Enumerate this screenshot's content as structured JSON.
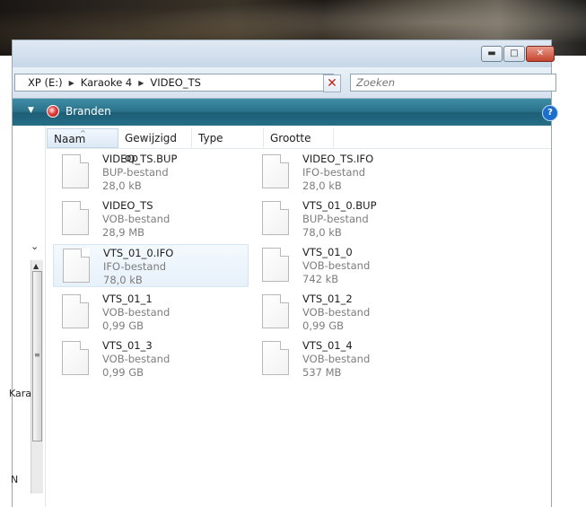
{
  "address": {
    "crumbs": [
      "XP (E:)",
      "Karaoke 4",
      "VIDEO_TS"
    ]
  },
  "search": {
    "placeholder": "Zoeken"
  },
  "toolbar": {
    "burn_label": "Branden"
  },
  "nav": {
    "text_1": "Kara",
    "text_2": "N"
  },
  "columns": [
    "Naam",
    "Gewijzigd op",
    "Type",
    "Grootte"
  ],
  "files": [
    {
      "name": "VIDEO_TS.BUP",
      "type": "BUP-bestand",
      "size": "28,0 kB"
    },
    {
      "name": "VIDEO_TS.IFO",
      "type": "IFO-bestand",
      "size": "28,0 kB"
    },
    {
      "name": "VIDEO_TS",
      "type": "VOB-bestand",
      "size": "28,9 MB"
    },
    {
      "name": "VTS_01_0.BUP",
      "type": "BUP-bestand",
      "size": "78,0 kB"
    },
    {
      "name": "VTS_01_0.IFO",
      "type": "IFO-bestand",
      "size": "78,0 kB"
    },
    {
      "name": "VTS_01_0",
      "type": "VOB-bestand",
      "size": "742 kB"
    },
    {
      "name": "VTS_01_1",
      "type": "VOB-bestand",
      "size": "0,99 GB"
    },
    {
      "name": "VTS_01_2",
      "type": "VOB-bestand",
      "size": "0,99 GB"
    },
    {
      "name": "VTS_01_3",
      "type": "VOB-bestand",
      "size": "0,99 GB"
    },
    {
      "name": "VTS_01_4",
      "type": "VOB-bestand",
      "size": "537 MB"
    }
  ],
  "colors": {
    "toolbar_top": "#3f8ea6",
    "toolbar_bottom": "#1d5e76",
    "selected_bg": "#e7f1fa",
    "close_red": "#c0241b"
  }
}
